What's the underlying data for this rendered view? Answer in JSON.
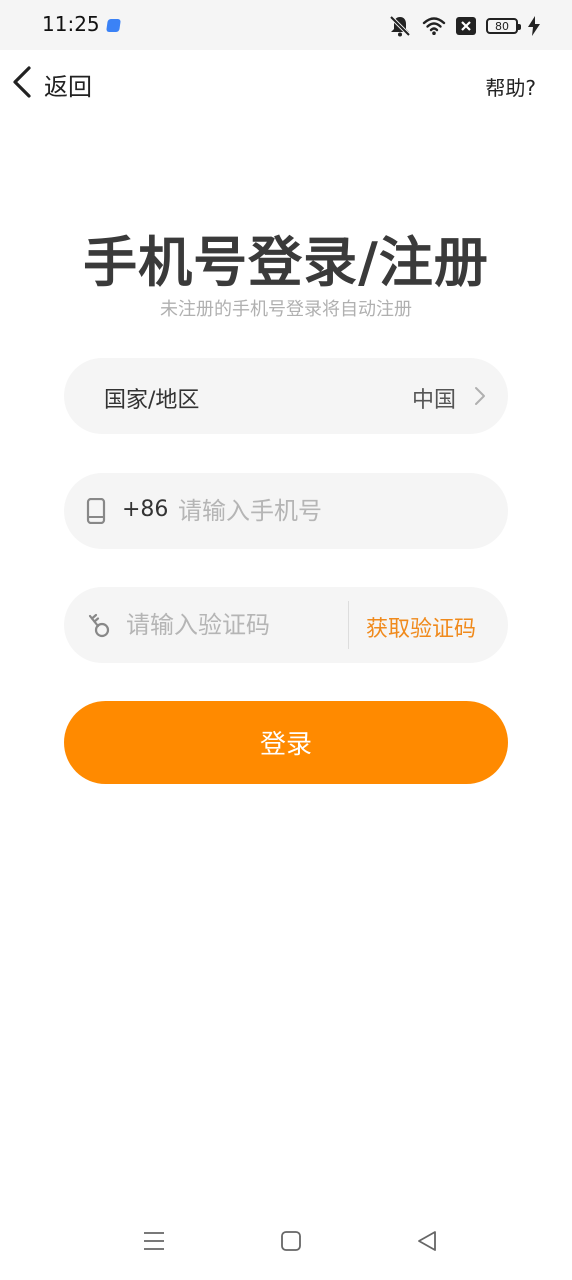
{
  "status_bar": {
    "time": "11:25",
    "battery_level": "80"
  },
  "topbar": {
    "back_label": "返回",
    "help_label": "帮助?"
  },
  "header": {
    "title": "手机号登录/注册",
    "subtitle": "未注册的手机号登录将自动注册"
  },
  "form": {
    "country": {
      "label": "国家/地区",
      "value": "中国"
    },
    "phone": {
      "country_code": "+86",
      "placeholder": "请输入手机号"
    },
    "code": {
      "placeholder": "请输入验证码",
      "get_code_label": "获取验证码"
    },
    "login_label": "登录"
  },
  "colors": {
    "accent": "#ff8a00",
    "get_code_text": "#f08a1c",
    "field_background": "#f5f5f5"
  },
  "icons": {
    "back": "chevron-left-icon",
    "country_chevron": "chevron-right-icon",
    "phone": "phone-icon",
    "code": "key-icon",
    "mute": "bell-off-icon",
    "wifi": "wifi-icon",
    "no_sim": "sim-off-icon",
    "battery": "battery-icon",
    "charging": "bolt-icon",
    "nav_menu": "menu-icon",
    "nav_home": "square-icon",
    "nav_back": "triangle-back-icon"
  }
}
